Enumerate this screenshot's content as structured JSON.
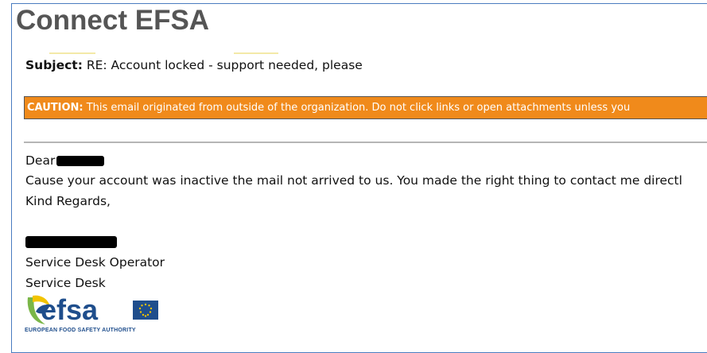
{
  "header": {
    "title": "Connect EFSA"
  },
  "email": {
    "subject_label": "Subject:",
    "subject_value": " RE: Account locked - support needed, please",
    "caution_label": "CAUTION:",
    "caution_text": " This email originated from outside of the organization. Do not click links or open attachments unless you",
    "greeting": "Dear",
    "body_line": "Cause your account was inactive the mail not arrived to us. You made the right thing to contact me directl",
    "closing": "Kind Regards,",
    "signature_role": "Service Desk Operator",
    "signature_dept": "Service Desk"
  },
  "logo": {
    "wordmark": "efsa",
    "tagline": "EUROPEAN FOOD SAFETY AUTHORITY"
  },
  "colors": {
    "caution_bg": "#f08a1b",
    "title": "#555555",
    "logo_blue": "#1f4e8c",
    "logo_green": "#7ab648",
    "logo_yellow": "#f2c300"
  }
}
